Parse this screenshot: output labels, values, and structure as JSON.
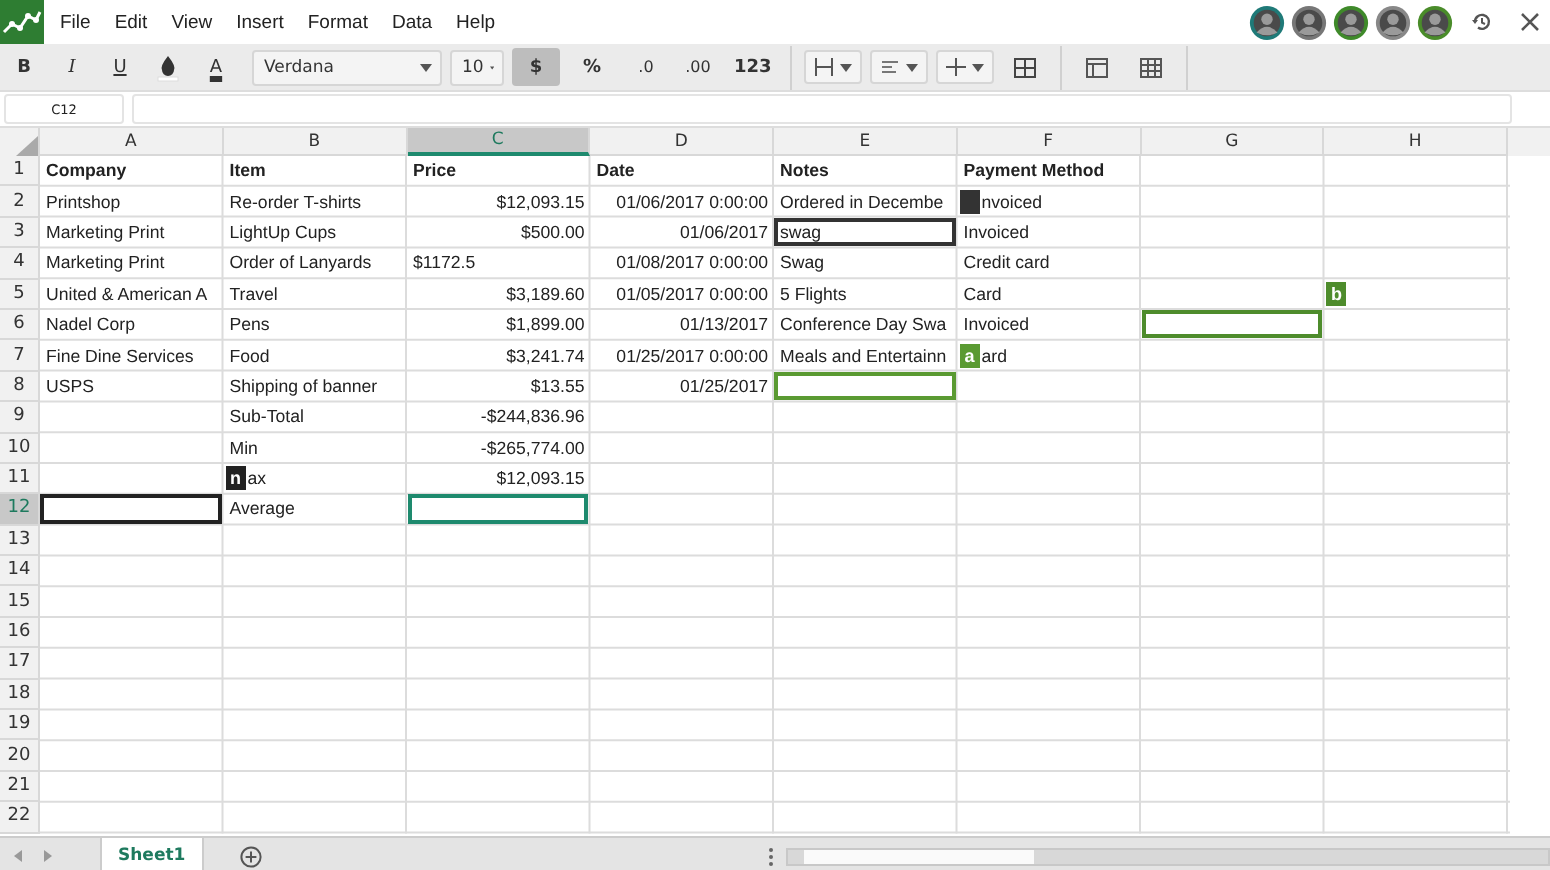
{
  "menu": [
    "File",
    "Edit",
    "View",
    "Insert",
    "Format",
    "Data",
    "Help"
  ],
  "toolbar": [
    {
      "kind": "bold",
      "label": "B",
      "selected": false
    },
    {
      "kind": "italic",
      "label": "I",
      "selected": false
    },
    {
      "kind": "underline",
      "label": "U",
      "selected": false
    },
    {
      "kind": "fill"
    },
    {
      "kind": "text-color",
      "label": "A"
    },
    {
      "kind": "font",
      "label": "Verdana"
    },
    {
      "kind": "size",
      "label": "10"
    },
    {
      "kind": "plain",
      "label": "$",
      "selected": true
    },
    {
      "kind": "plain",
      "label": "%",
      "selected": false
    },
    {
      "kind": "decimal",
      "label": ".0",
      "selected": false
    },
    {
      "kind": "decimal",
      "label": ".00",
      "selected": false
    },
    {
      "kind": "plain",
      "label": "123",
      "selected": false
    }
  ],
  "name_box": "C12",
  "columns": [
    {
      "label": "A",
      "selected": false
    },
    {
      "label": "B",
      "selected": false
    },
    {
      "label": "C",
      "selected": true
    },
    {
      "label": "D",
      "selected": false
    },
    {
      "label": "E",
      "selected": false
    },
    {
      "label": "F",
      "selected": false
    },
    {
      "label": "G",
      "selected": false
    },
    {
      "label": "H",
      "selected": false
    }
  ],
  "rows": [
    {
      "number": "1",
      "selected": false,
      "kind": "header",
      "cells": [
        {
          "text": "Company"
        },
        {
          "text": "Item"
        },
        {
          "text": "Price"
        },
        {
          "text": "Date"
        },
        {
          "text": "Notes"
        },
        {
          "text": "Payment Method"
        },
        {},
        {}
      ]
    },
    {
      "number": "2",
      "selected": false,
      "cells": [
        {
          "text": "Printshop"
        },
        {
          "text": "Re-order T-shirts"
        },
        {
          "text": "$12,093.15",
          "kind": "number"
        },
        {
          "text": "01/06/2017 0:00:00",
          "kind": "number"
        },
        {
          "text": "Ordered in Decembe"
        },
        {
          "text": "nvoiced"
        },
        {},
        {}
      ]
    },
    {
      "number": "3",
      "selected": false,
      "cells": [
        {
          "text": "Marketing Print"
        },
        {
          "text": "LightUp Cups"
        },
        {
          "text": "$500.00",
          "kind": "number"
        },
        {
          "text": "01/06/2017",
          "kind": "number"
        },
        {
          "text": "swag",
          "cursor": {
            "kind": "collaborator",
            "color": "#333333"
          }
        },
        {
          "text": "Invoiced"
        },
        {},
        {}
      ]
    },
    {
      "number": "4",
      "selected": false,
      "cells": [
        {
          "text": "Marketing Print"
        },
        {
          "text": "Order of Lanyards"
        },
        {
          "text": "$1172.5"
        },
        {
          "text": "01/08/2017 0:00:00",
          "kind": "number"
        },
        {
          "text": "Swag"
        },
        {
          "text": "Credit card"
        },
        {},
        {}
      ]
    },
    {
      "number": "5",
      "selected": false,
      "cells": [
        {
          "text": "United & American A"
        },
        {
          "text": "Travel"
        },
        {
          "text": "$3,189.60",
          "kind": "number"
        },
        {
          "text": "01/05/2017 0:00:00",
          "kind": "number"
        },
        {
          "text": "5 Flights"
        },
        {
          "text": "Card"
        },
        {},
        {}
      ]
    },
    {
      "number": "6",
      "selected": false,
      "cells": [
        {
          "text": "Nadel Corp"
        },
        {
          "text": "Pens"
        },
        {
          "text": "$1,899.00",
          "kind": "number"
        },
        {
          "text": "01/13/2017",
          "kind": "number"
        },
        {
          "text": "Conference Day Swa"
        },
        {
          "text": "Invoiced"
        },
        {
          "cursor": {
            "kind": "collaborator",
            "color": "#4e8c2c",
            "label": "b"
          }
        },
        {}
      ]
    },
    {
      "number": "7",
      "selected": false,
      "cells": [
        {
          "text": "Fine Dine Services"
        },
        {
          "text": "Food"
        },
        {
          "text": "$3,241.74",
          "kind": "number"
        },
        {
          "text": "01/25/2017 0:00:00",
          "kind": "number"
        },
        {
          "text": "Meals and Entertainn"
        },
        {
          "text": "ard"
        },
        {},
        {}
      ]
    },
    {
      "number": "8",
      "selected": false,
      "cells": [
        {
          "text": "USPS"
        },
        {
          "text": "Shipping of banner"
        },
        {
          "text": "$13.55",
          "kind": "number"
        },
        {
          "text": "01/25/2017",
          "kind": "number"
        },
        {
          "cursor": {
            "kind": "collaborator",
            "color": "#5a9a32",
            "label": "a"
          }
        },
        {},
        {},
        {}
      ]
    },
    {
      "number": "9",
      "selected": false,
      "cells": [
        {},
        {
          "text": "Sub-Total"
        },
        {
          "text": "-$244,836.96",
          "kind": "number"
        },
        {},
        {},
        {},
        {},
        {}
      ]
    },
    {
      "number": "10",
      "selected": false,
      "cells": [
        {},
        {
          "text": "Min"
        },
        {
          "text": "-$265,774.00",
          "kind": "number"
        },
        {},
        {},
        {},
        {},
        {}
      ]
    },
    {
      "number": "11",
      "selected": false,
      "cells": [
        {},
        {
          "text": "ax"
        },
        {
          "text": "$12,093.15",
          "kind": "number"
        },
        {},
        {},
        {},
        {},
        {}
      ]
    },
    {
      "number": "12",
      "selected": true,
      "cells": [
        {
          "cursor": {
            "kind": "collaborator",
            "color": "#222222",
            "label": "n"
          }
        },
        {
          "text": "Average"
        },
        {
          "cursor": {
            "kind": "own",
            "color": "#1e8a6e"
          }
        },
        {},
        {},
        {},
        {},
        {}
      ]
    },
    {
      "number": "13",
      "selected": false
    },
    {
      "number": "14",
      "selected": false
    },
    {
      "number": "15",
      "selected": false
    },
    {
      "number": "16",
      "selected": false
    },
    {
      "number": "17",
      "selected": false
    },
    {
      "number": "18",
      "selected": false
    },
    {
      "number": "19",
      "selected": false
    },
    {
      "number": "20",
      "selected": false
    },
    {
      "number": "21",
      "selected": false
    },
    {
      "number": "22",
      "selected": false
    }
  ],
  "sheets": [
    {
      "label": "Sheet1",
      "selected": true
    }
  ]
}
